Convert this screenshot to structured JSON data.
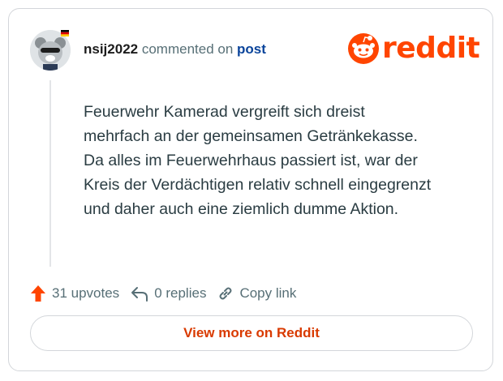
{
  "header": {
    "username": "nsij2022",
    "action_text": "commented on",
    "post_link": "post"
  },
  "brand": {
    "logo_text": "reddit",
    "color": "#ff4500"
  },
  "comment": {
    "lines": [
      "Feuerwehr Kamerad vergreift sich dreist",
      "mehrfach an der gemeinsamen Getränkekasse.",
      "Da alles im Feuerwehrhaus passiert ist, war der",
      "Kreis der Verdächtigen relativ schnell eingegrenzt",
      "und daher auch eine ziemlich dumme Aktion."
    ]
  },
  "actions": {
    "upvotes": "31 upvotes",
    "replies": "0 replies",
    "copy_link": "Copy link"
  },
  "footer": {
    "view_more": "View more on Reddit"
  },
  "colors": {
    "upvote": "#ff4500",
    "link": "#0a449b",
    "button_text": "#d93a00"
  },
  "icons": [
    "avatar",
    "german-flag-icon",
    "reddit-logo-icon",
    "upvote-arrow-icon",
    "reply-icon",
    "link-icon"
  ]
}
